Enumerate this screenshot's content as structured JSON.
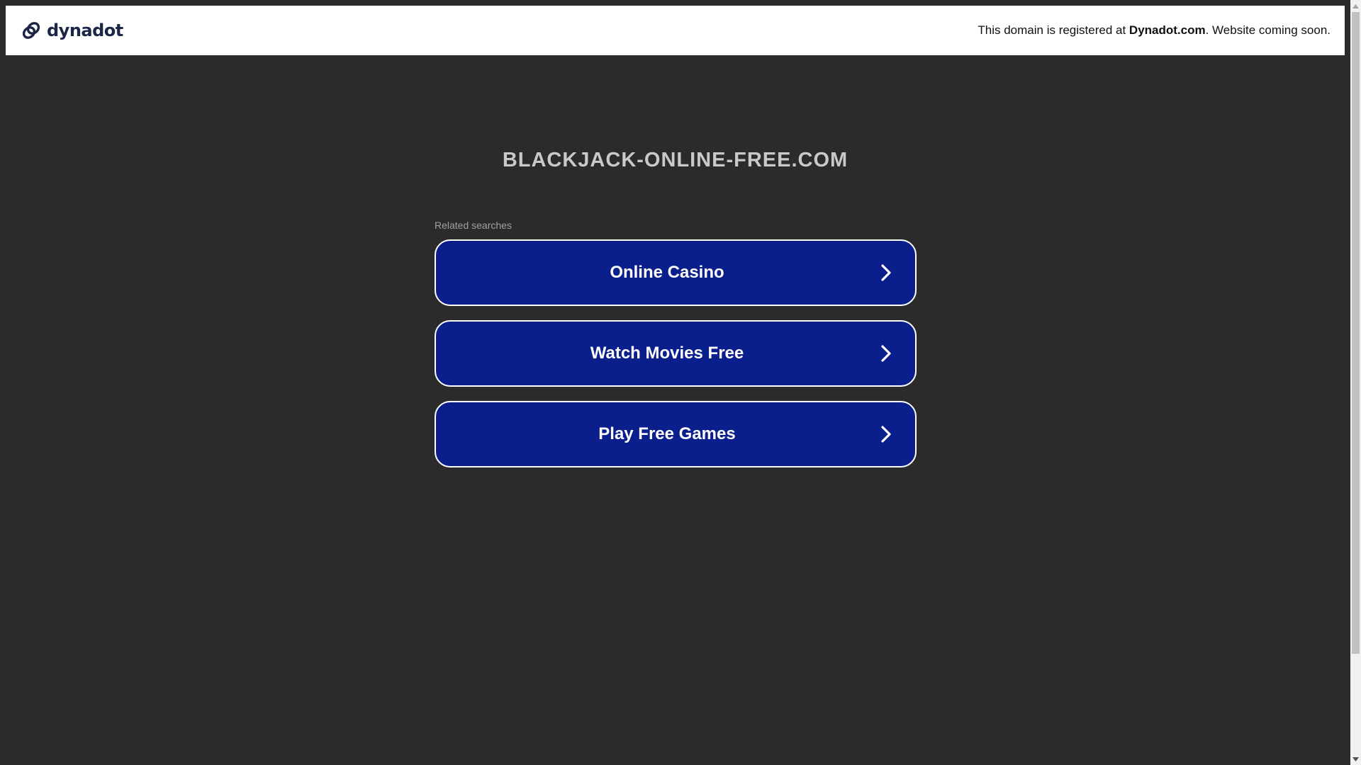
{
  "header": {
    "logo_text": "dynadot",
    "logo_icon": "dynadot-link-icon",
    "registered_prefix": "This domain is registered at ",
    "registered_brand": "Dynadot.com",
    "registered_suffix": ". Website coming soon."
  },
  "main": {
    "domain": "BLACKJACK-ONLINE-FREE.COM",
    "related_label": "Related searches",
    "links": [
      {
        "label": "Online Casino",
        "icon": "chevron-right-icon"
      },
      {
        "label": "Watch Movies Free",
        "icon": "chevron-right-icon"
      },
      {
        "label": "Play Free Games",
        "icon": "chevron-right-icon"
      }
    ]
  },
  "colors": {
    "page_background": "#2b2b2b",
    "header_background": "#ffffff",
    "button_background": "#0a1e8c",
    "button_border": "#ffffff",
    "domain_text": "#c9c9c9",
    "logo_text": "#1c2447"
  }
}
